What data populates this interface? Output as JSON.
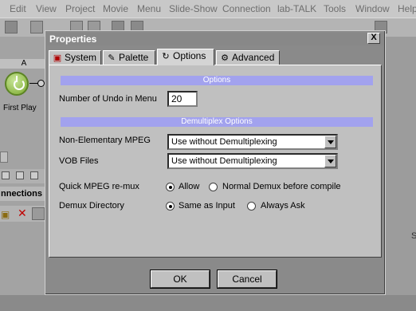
{
  "app": {
    "menu": [
      "Edit",
      "View",
      "Project",
      "Movie",
      "Menu",
      "Slide-Show",
      "Connection",
      "lab-TALK",
      "Tools",
      "Window",
      "Help"
    ],
    "column_a_label": "A",
    "node_label": "First Play",
    "connections_label": "nnections",
    "right_edge_letter": "S"
  },
  "dialog": {
    "title": "Properties",
    "close_label": "X",
    "tabs": [
      {
        "label": "System",
        "icon": "system-icon"
      },
      {
        "label": "Palette",
        "icon": "palette-icon"
      },
      {
        "label": "Options",
        "icon": "options-icon",
        "active": true
      },
      {
        "label": "Advanced",
        "icon": "advanced-icon"
      }
    ],
    "options_section": "Options",
    "undo_label": "Number of Undo in Menu",
    "undo_value": "20",
    "demux_section": "Demultiplex Options",
    "non_elementary_label": "Non-Elementary MPEG",
    "non_elementary_value": "Use without Demultiplexing",
    "vob_label": "VOB Files",
    "vob_value": "Use without Demultiplexing",
    "quick_remux_label": "Quick MPEG re-mux",
    "quick_remux_options": [
      {
        "label": "Allow",
        "checked": true
      },
      {
        "label": "Normal Demux before compile",
        "checked": false
      }
    ],
    "demux_dir_label": "Demux Directory",
    "demux_dir_options": [
      {
        "label": "Same as Input",
        "checked": true
      },
      {
        "label": "Always Ask",
        "checked": false
      }
    ],
    "ok_label": "OK",
    "cancel_label": "Cancel"
  },
  "colors": {
    "section_header": "#a2a2ee",
    "dialog_panel": "#c0c0c0",
    "dim_overlay": "#8a8a8a"
  }
}
